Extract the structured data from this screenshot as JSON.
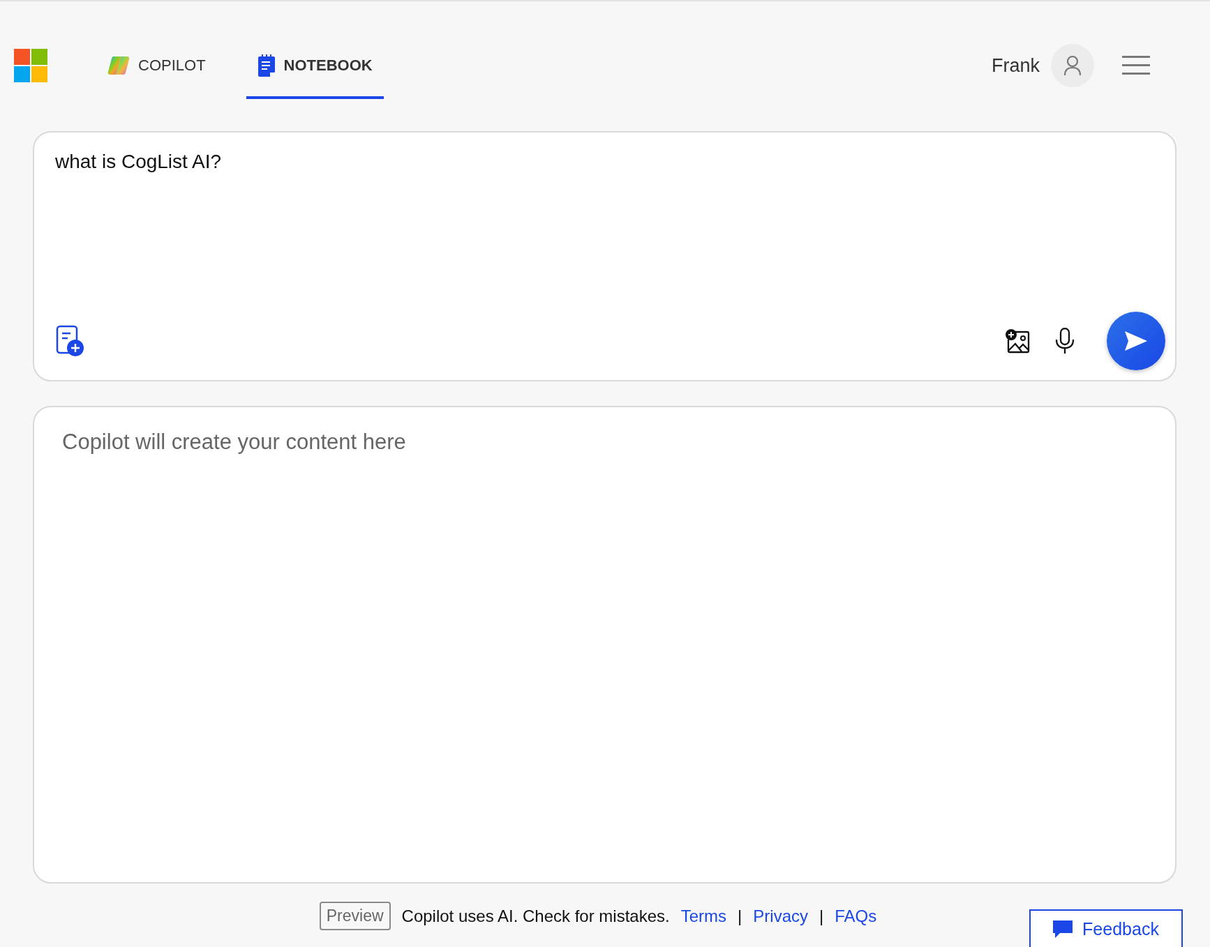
{
  "header": {
    "tabs": [
      {
        "kind": "copilot",
        "label": "COPILOT",
        "selected": false
      },
      {
        "kind": "notebook",
        "label": "NOTEBOOK",
        "selected": true
      }
    ],
    "user": {
      "name": "Frank"
    }
  },
  "prompt": {
    "value": "what is CogList AI?"
  },
  "output": {
    "placeholder": "Copilot will create your content here"
  },
  "footer": {
    "badge": "Preview",
    "notice": "Copilot uses AI. Check for mistakes.",
    "links": [
      {
        "label": "Terms"
      },
      {
        "separator": "|",
        "label": "Privacy"
      },
      {
        "separator": "|",
        "label": "FAQs"
      }
    ]
  },
  "feedback": {
    "label": "Feedback"
  }
}
